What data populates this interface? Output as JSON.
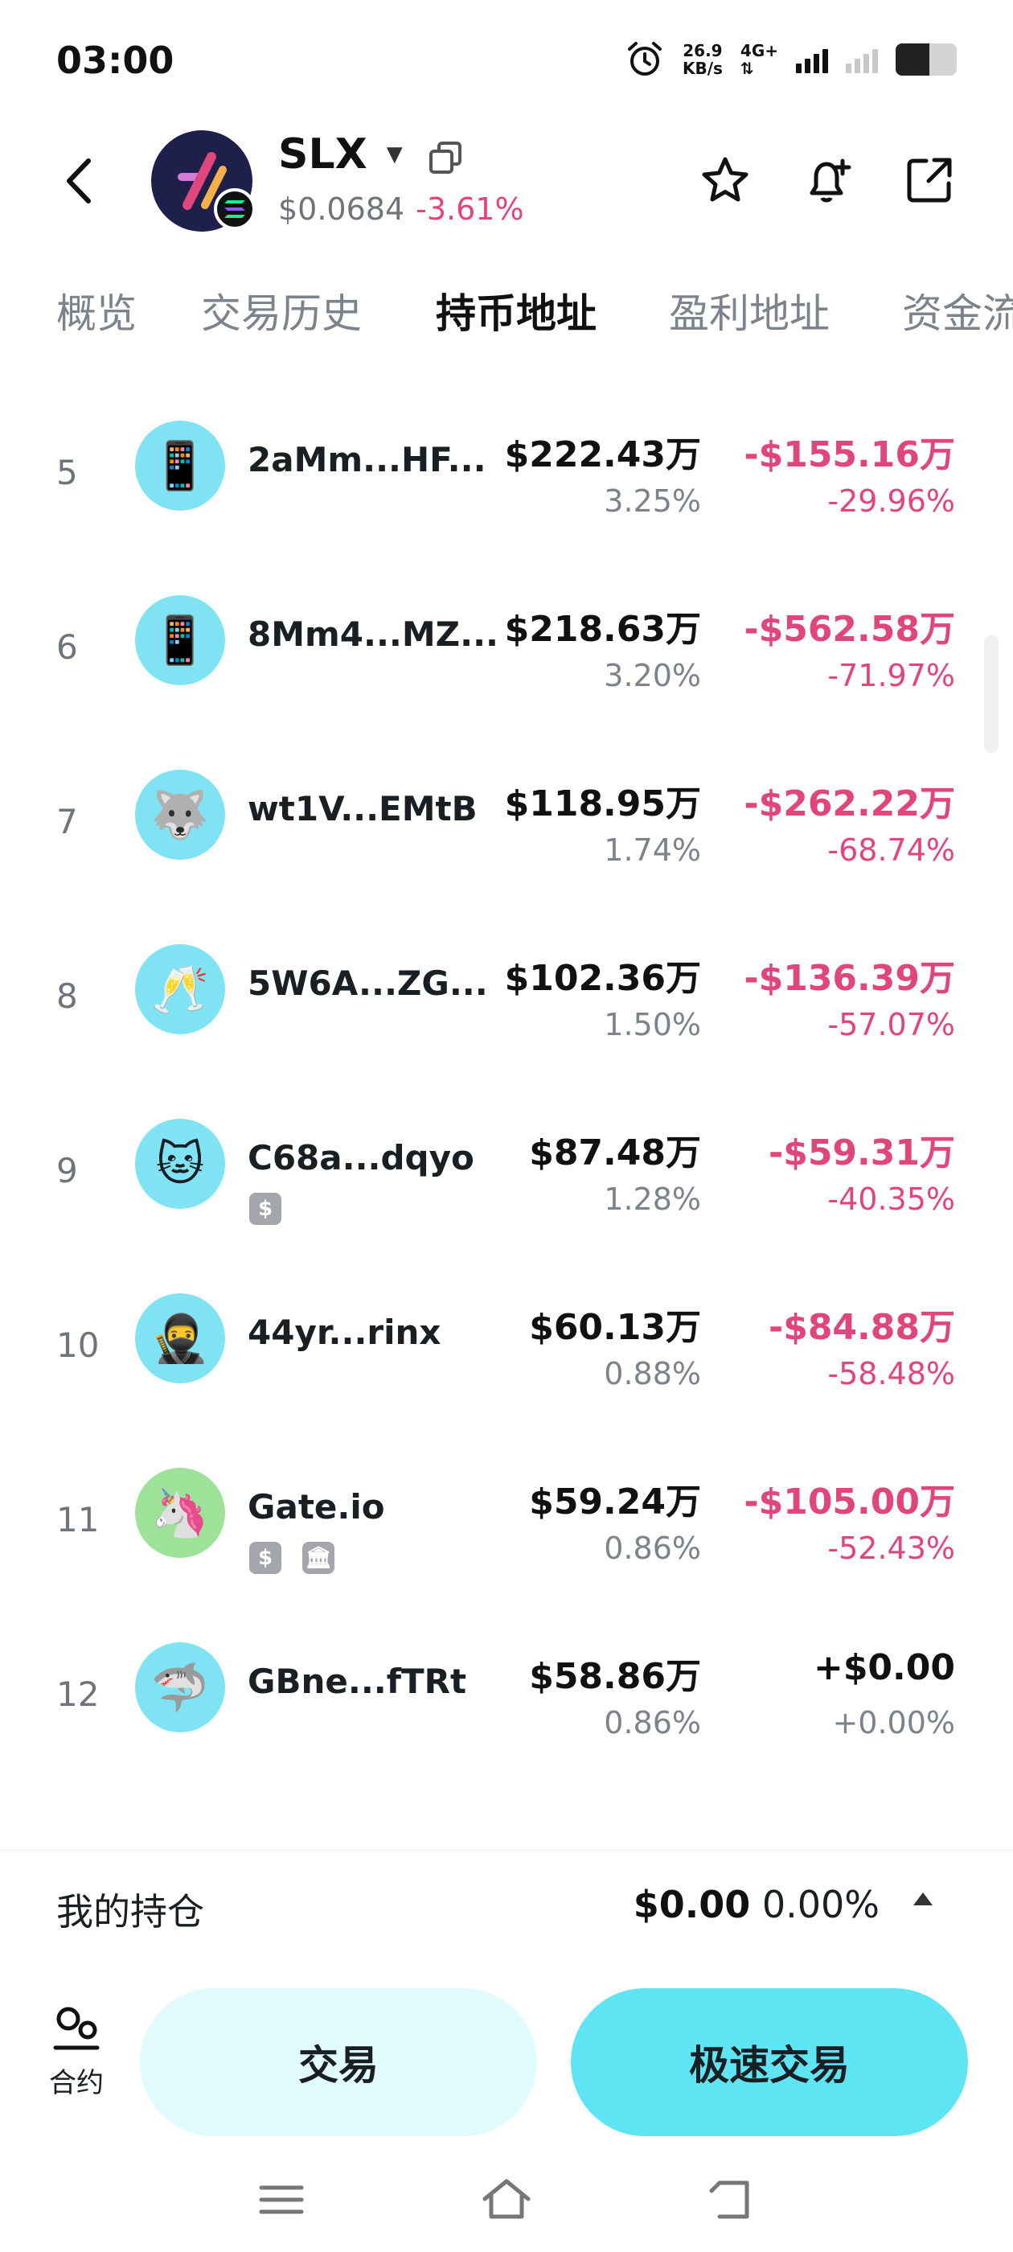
{
  "status_bar": {
    "time": "03:00",
    "net_speed_value": "26.9",
    "net_speed_unit": "KB/s",
    "network_type": "4G+",
    "battery_level": 0.55
  },
  "header": {
    "token_symbol": "SLX",
    "price": "$0.0684",
    "price_change": "-3.61%"
  },
  "tabs": [
    {
      "label": "概览",
      "active": false
    },
    {
      "label": "交易历史",
      "active": false
    },
    {
      "label": "持币地址",
      "active": true
    },
    {
      "label": "盈利地址",
      "active": false
    },
    {
      "label": "资金流",
      "active": false
    }
  ],
  "holders": [
    {
      "rank": "5",
      "avatar": "📱",
      "address": "2aMm...HF...",
      "value": "$222.43万",
      "percent": "3.25%",
      "pnl": "-$155.16万",
      "pnl_percent": "-29.96%",
      "badges": []
    },
    {
      "rank": "6",
      "avatar": "📱",
      "address": "8Mm4...MZ...",
      "value": "$218.63万",
      "percent": "3.20%",
      "pnl": "-$562.58万",
      "pnl_percent": "-71.97%",
      "badges": []
    },
    {
      "rank": "7",
      "avatar": "🐺",
      "address": "wt1V...EMtB",
      "value": "$118.95万",
      "percent": "1.74%",
      "pnl": "-$262.22万",
      "pnl_percent": "-68.74%",
      "badges": []
    },
    {
      "rank": "8",
      "avatar": "🥂",
      "address": "5W6A...ZG...",
      "value": "$102.36万",
      "percent": "1.50%",
      "pnl": "-$136.39万",
      "pnl_percent": "-57.07%",
      "badges": []
    },
    {
      "rank": "9",
      "avatar": "🐱",
      "address": "C68a...dqyo",
      "value": "$87.48万",
      "percent": "1.28%",
      "pnl": "-$59.31万",
      "pnl_percent": "-40.35%",
      "badges": [
        "$"
      ]
    },
    {
      "rank": "10",
      "avatar": "🥷",
      "address": "44yr...rinx",
      "value": "$60.13万",
      "percent": "0.88%",
      "pnl": "-$84.88万",
      "pnl_percent": "-58.48%",
      "badges": []
    },
    {
      "rank": "11",
      "avatar": "🦄",
      "address": "Gate.io",
      "value": "$59.24万",
      "percent": "0.86%",
      "pnl": "-$105.00万",
      "pnl_percent": "-52.43%",
      "badges": [
        "$",
        "🏛"
      ]
    },
    {
      "rank": "12",
      "avatar": "🦈",
      "address": "GBne...fTRt",
      "value": "$58.86万",
      "percent": "0.86%",
      "pnl": "+$0.00",
      "pnl_percent": "+0.00%",
      "badges": []
    }
  ],
  "my_position": {
    "label": "我的持仓",
    "value": "$0.00",
    "percent": "0.00%"
  },
  "actions": {
    "contract_label": "合约",
    "trade_label": "交易",
    "fast_trade_label": "极速交易"
  },
  "colors": {
    "negative": "#e0457b",
    "accent": "#5ee4f2",
    "accent_light": "#e1fbfd"
  }
}
